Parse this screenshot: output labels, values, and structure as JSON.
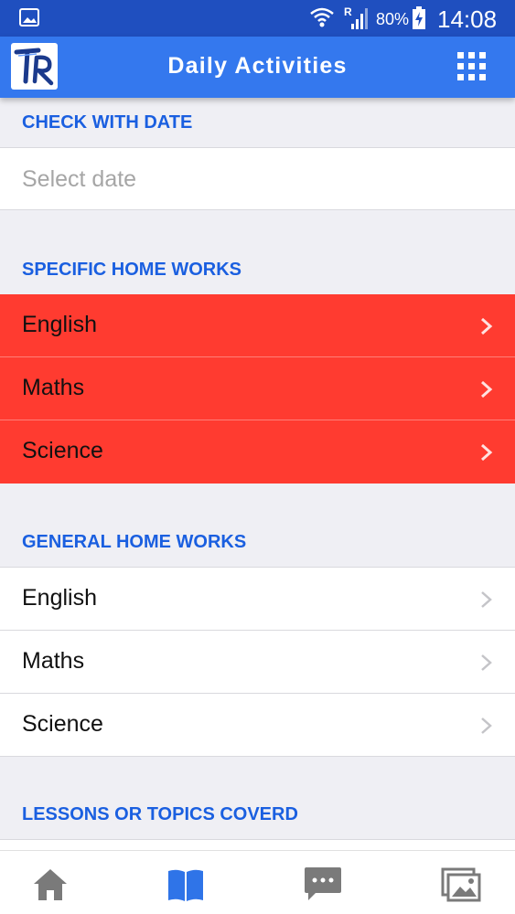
{
  "status_bar": {
    "network_label": "R",
    "battery_percent": "80%",
    "time": "14:08"
  },
  "app_bar": {
    "logo_text": "TR",
    "title": "Daily Activities",
    "menu_icon": "grid-icon"
  },
  "check_with_date": {
    "header": "CHECK WITH DATE",
    "placeholder": "Select date"
  },
  "specific_home_works": {
    "header": "SPECIFIC HOME WORKS",
    "color": "#ff3b30",
    "items": [
      {
        "label": "English"
      },
      {
        "label": "Maths"
      },
      {
        "label": "Science"
      }
    ]
  },
  "general_home_works": {
    "header": "GENERAL HOME WORKS",
    "items": [
      {
        "label": "English"
      },
      {
        "label": "Maths"
      },
      {
        "label": "Science"
      }
    ]
  },
  "lessons": {
    "header": "LESSONS OR TOPICS COVERD"
  },
  "tab_bar": {
    "tabs": [
      {
        "icon": "home-icon",
        "active": false
      },
      {
        "icon": "book-icon",
        "active": true
      },
      {
        "icon": "chat-icon",
        "active": false
      },
      {
        "icon": "gallery-icon",
        "active": false
      }
    ]
  },
  "colors": {
    "status_bar": "#1f4fbf",
    "app_bar": "#3478ee",
    "section_header": "#1a5fe0",
    "active_tab": "#2f74e8",
    "inactive_tab": "#7a7a7a"
  }
}
